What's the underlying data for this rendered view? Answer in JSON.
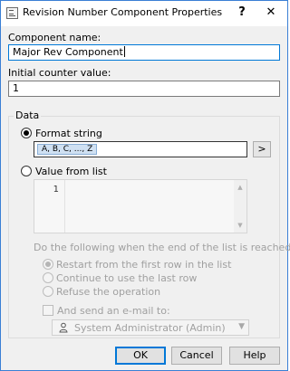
{
  "window": {
    "title": "Revision Number Component Properties",
    "help_glyph": "?",
    "close_glyph": "✕"
  },
  "component_name": {
    "label": "Component name:",
    "value": "Major Rev Component"
  },
  "initial_counter": {
    "label": "Initial counter value:",
    "value": "1"
  },
  "data_group": {
    "title": "Data",
    "format_string": {
      "label": "Format string",
      "selected": true,
      "token": "A, B, C, ..., Z",
      "arrow_label": ">"
    },
    "value_from_list": {
      "label": "Value from list",
      "selected": false,
      "line_number": "1"
    },
    "end_of_list": {
      "prompt": "Do the following when the end of the list is reached:",
      "options": [
        {
          "label": "Restart from the first row in the list",
          "selected": true
        },
        {
          "label": "Continue to use the last row",
          "selected": false
        },
        {
          "label": "Refuse the operation",
          "selected": false
        }
      ]
    },
    "email": {
      "label": "And send an e-mail to:",
      "checked": false,
      "recipient": "System Administrator (Admin)"
    }
  },
  "buttons": {
    "ok": "OK",
    "cancel": "Cancel",
    "help": "Help"
  },
  "colors": {
    "window_border": "#3a7fd5",
    "focus_border": "#0078d7",
    "token_bg": "#cfe0f2",
    "disabled_text": "#a0a0a0"
  }
}
